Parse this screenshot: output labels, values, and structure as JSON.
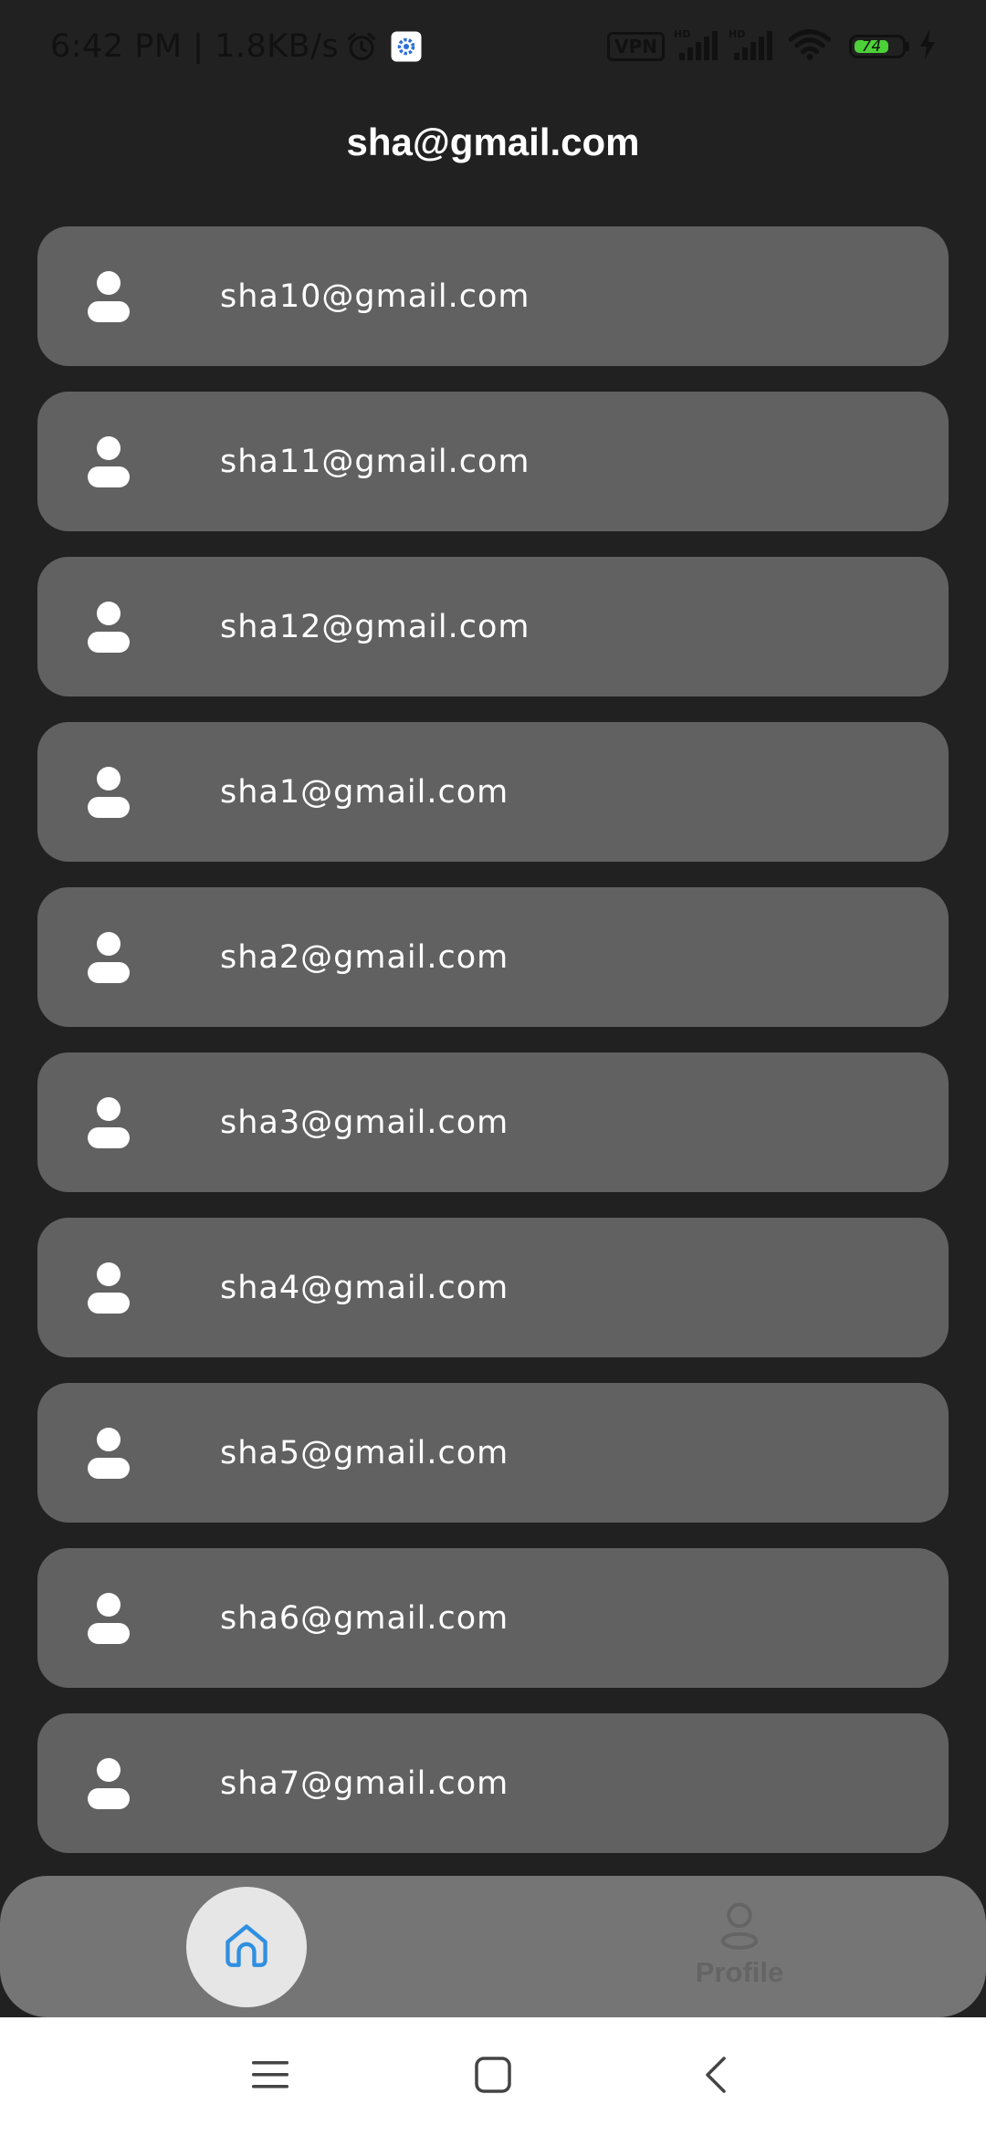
{
  "status_bar": {
    "time_speed": "6:42 PM | 1.8KB/s",
    "vpn_label": "VPN",
    "battery_level": "74",
    "icons": [
      "alarm-icon",
      "gear-notification-icon",
      "signal-hd-icon",
      "signal-hd-icon",
      "wifi-icon",
      "battery-icon",
      "charging-icon"
    ]
  },
  "header": {
    "title": "sha@gmail.com"
  },
  "users": [
    {
      "email": "sha10@gmail.com"
    },
    {
      "email": "sha11@gmail.com"
    },
    {
      "email": "sha12@gmail.com"
    },
    {
      "email": "sha1@gmail.com"
    },
    {
      "email": "sha2@gmail.com"
    },
    {
      "email": "sha3@gmail.com"
    },
    {
      "email": "sha4@gmail.com"
    },
    {
      "email": "sha5@gmail.com"
    },
    {
      "email": "sha6@gmail.com"
    },
    {
      "email": "sha7@gmail.com"
    }
  ],
  "bottom_nav": {
    "home_icon": "home-icon",
    "profile_label": "Profile",
    "active_color": "#2f8fe0"
  },
  "system_nav": {
    "icons": [
      "menu-icon",
      "home-square-icon",
      "back-icon"
    ]
  }
}
